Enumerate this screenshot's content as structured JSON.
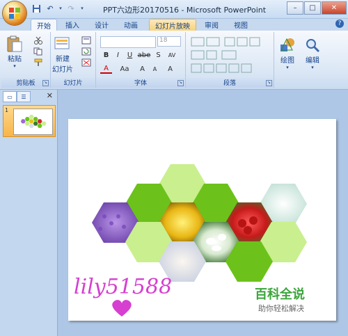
{
  "window": {
    "title": "PPT六边形20170516 - Microsoft PowerPoint",
    "controls": {
      "minimize": "–",
      "maximize": "□",
      "close": "✕"
    }
  },
  "tabs": [
    {
      "label": "开始"
    },
    {
      "label": "插入"
    },
    {
      "label": "设计"
    },
    {
      "label": "动画"
    },
    {
      "label": "幻灯片放映"
    },
    {
      "label": "审阅"
    },
    {
      "label": "视图"
    }
  ],
  "ribbon": {
    "clipboard": {
      "paste": "粘贴",
      "label": "剪贴板"
    },
    "slides": {
      "new_slide": "新建\n幻灯片",
      "new_slide_line1": "新建",
      "new_slide_line2": "幻灯片",
      "label": "幻灯片"
    },
    "font": {
      "font_name": "",
      "font_size": "18",
      "bold": "B",
      "italic": "I",
      "underline": "U",
      "strike": "abe",
      "shadow": "S",
      "spacing": "AV",
      "case": "Aa",
      "grow": "A",
      "shrink": "A",
      "clear": "A",
      "color": "A",
      "label": "字体"
    },
    "paragraph": {
      "label": "段落"
    },
    "drawing": {
      "label": "绘图"
    },
    "editing": {
      "label": "编辑"
    }
  },
  "help": "?",
  "panel": {
    "close": "✕",
    "slide_number": "1"
  },
  "slide": {
    "watermark_left": "lily51588",
    "brand": "百科全说",
    "brand_sub": "助你轻松解决"
  },
  "colors": {
    "green": "#6cc21a",
    "light_green": "#c9ef8f",
    "brand": "#3aa53a",
    "pink": "#d63fd0"
  }
}
